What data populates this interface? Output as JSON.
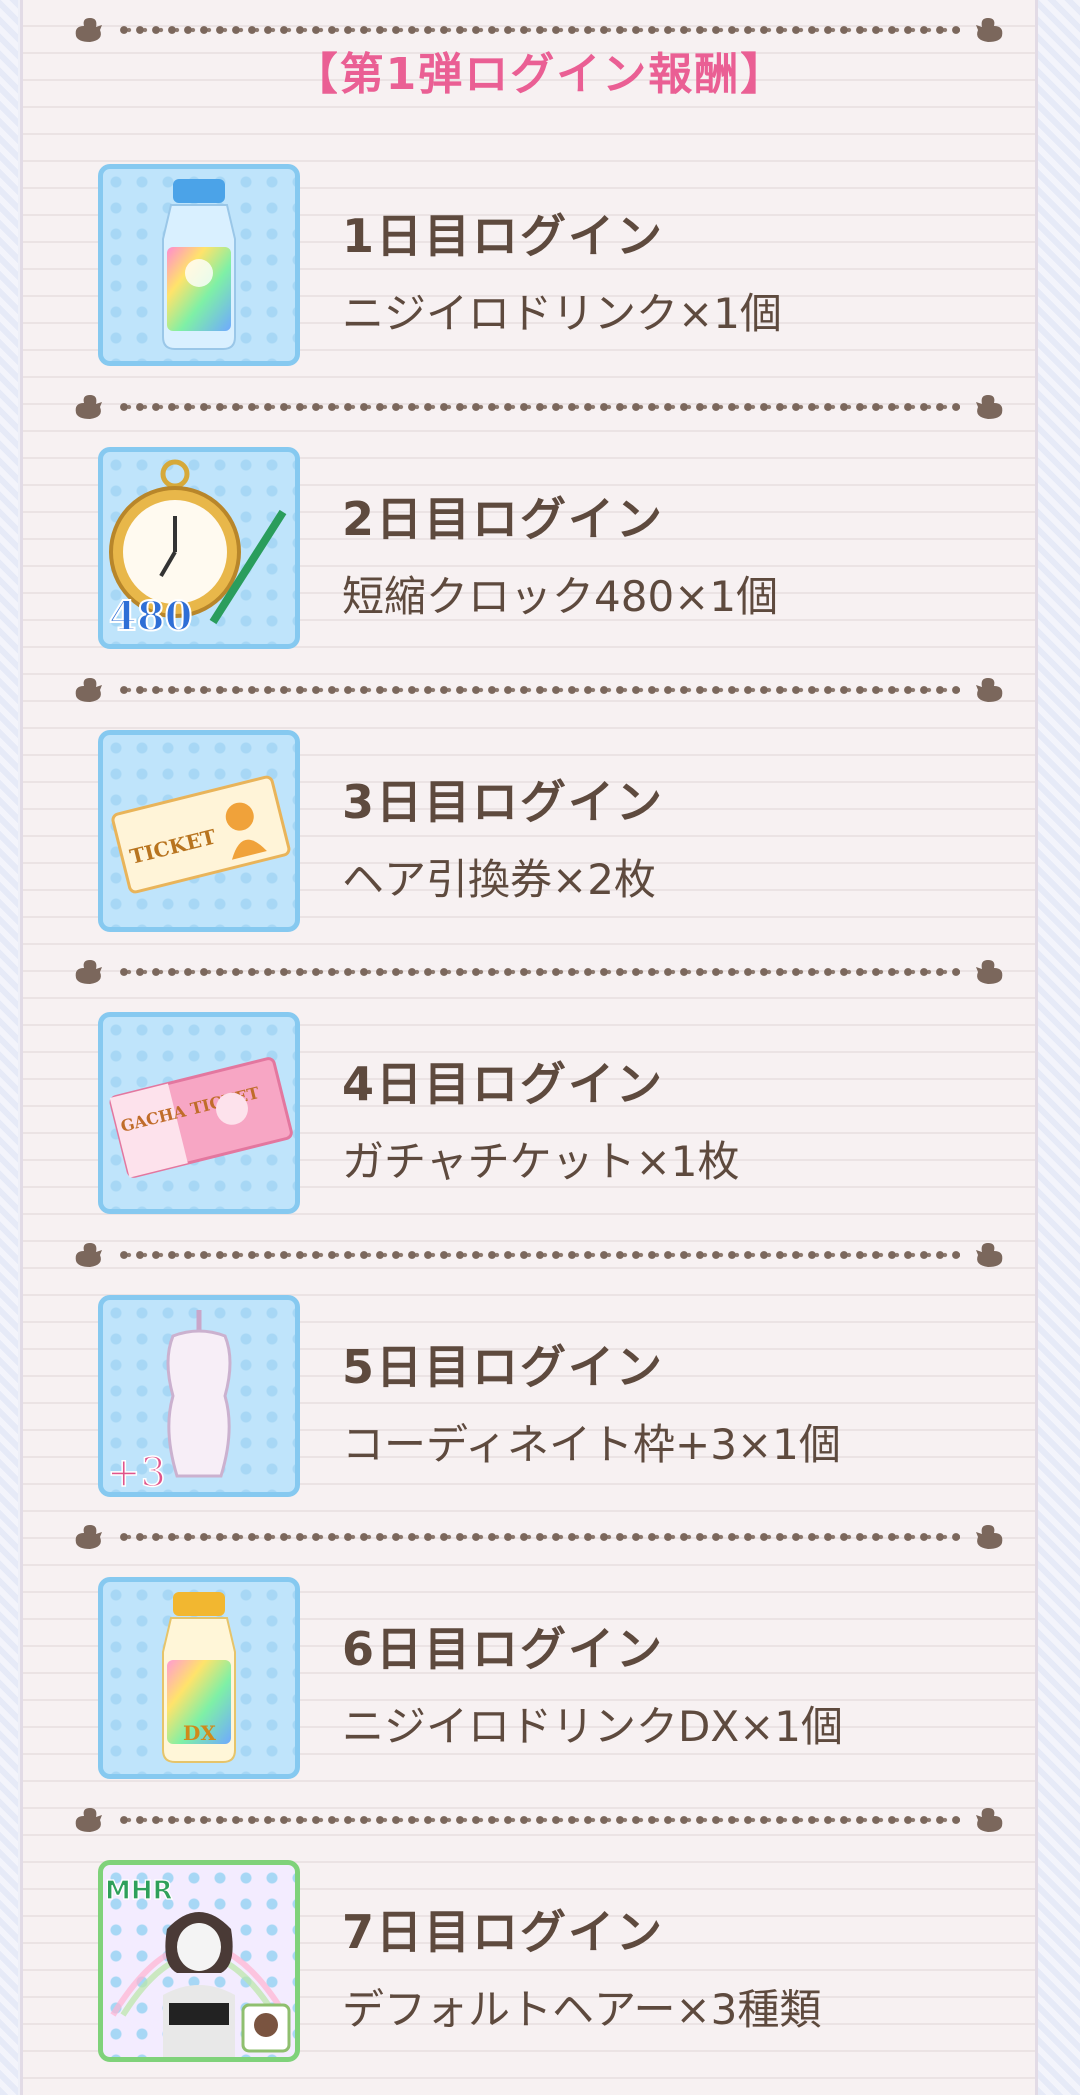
{
  "header": {
    "title": "【第1弾ログイン報酬】"
  },
  "rewards": [
    {
      "day": "1日目ログイン",
      "item": "ニジイロドリンク×1個",
      "icon": "rainbow-drink-icon"
    },
    {
      "day": "2日目ログイン",
      "item": "短縮クロック480×1個",
      "icon": "pocket-watch-icon",
      "badge": "480"
    },
    {
      "day": "3日目ログイン",
      "item": "ヘア引換券×2枚",
      "icon": "hair-ticket-icon",
      "badge": "TICKET"
    },
    {
      "day": "4日目ログイン",
      "item": "ガチャチケット×1枚",
      "icon": "gacha-ticket-icon",
      "badge": "GACHA TICKET"
    },
    {
      "day": "5日目ログイン",
      "item": "コーディネイト枠+3×1個",
      "icon": "mannequin-icon",
      "badge": "+3"
    },
    {
      "day": "6日目ログイン",
      "item": "ニジイロドリンクDX×1個",
      "icon": "rainbow-drink-dx-icon",
      "badge": "DX"
    },
    {
      "day": "7日目ログイン",
      "item": "デフォルトヘアー×3種類",
      "icon": "default-hair-icon",
      "badge": "MHR"
    }
  ],
  "colors": {
    "title": "#ea5f94",
    "text": "#5e4a3e",
    "icon_border": "#86c9f0"
  }
}
